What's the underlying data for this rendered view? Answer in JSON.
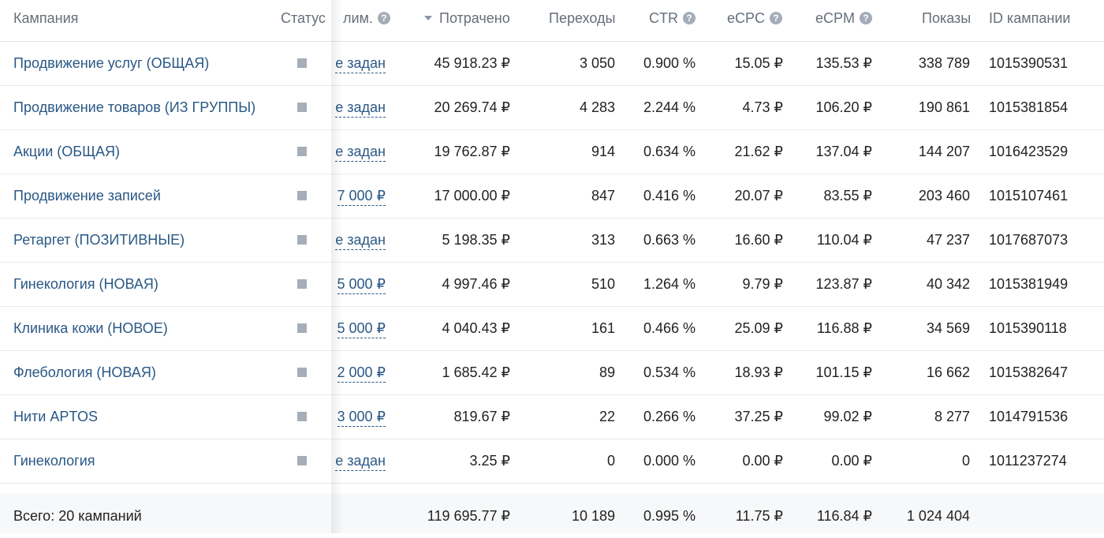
{
  "headers": {
    "campaign": "Кампания",
    "status": "Статус",
    "limit": "лим.",
    "spent": "Потрачено",
    "clicks": "Переходы",
    "ctr": "CTR",
    "ecpc": "eCPC",
    "ecpm": "eCPM",
    "impressions": "Показы",
    "campaign_id": "ID кампании",
    "help_glyph": "?"
  },
  "rows": [
    {
      "name": "Продвижение услуг (ОБЩАЯ)",
      "limit": "е задан",
      "spent": "45 918.23 ₽",
      "clicks": "3 050",
      "ctr": "0.900 %",
      "ecpc": "15.05 ₽",
      "ecpm": "135.53 ₽",
      "impressions": "338 789",
      "id": "1015390531"
    },
    {
      "name": "Продвижение товаров (ИЗ ГРУППЫ)",
      "limit": "е задан",
      "spent": "20 269.74 ₽",
      "clicks": "4 283",
      "ctr": "2.244 %",
      "ecpc": "4.73 ₽",
      "ecpm": "106.20 ₽",
      "impressions": "190 861",
      "id": "1015381854"
    },
    {
      "name": "Акции (ОБЩАЯ)",
      "limit": "е задан",
      "spent": "19 762.87 ₽",
      "clicks": "914",
      "ctr": "0.634 %",
      "ecpc": "21.62 ₽",
      "ecpm": "137.04 ₽",
      "impressions": "144 207",
      "id": "1016423529"
    },
    {
      "name": "Продвижение записей",
      "limit": "7 000 ₽",
      "spent": "17 000.00 ₽",
      "clicks": "847",
      "ctr": "0.416 %",
      "ecpc": "20.07 ₽",
      "ecpm": "83.55 ₽",
      "impressions": "203 460",
      "id": "1015107461"
    },
    {
      "name": "Ретаргет (ПОЗИТИВНЫЕ)",
      "limit": "е задан",
      "spent": "5 198.35 ₽",
      "clicks": "313",
      "ctr": "0.663 %",
      "ecpc": "16.60 ₽",
      "ecpm": "110.04 ₽",
      "impressions": "47 237",
      "id": "1017687073"
    },
    {
      "name": "Гинекология (НОВАЯ)",
      "limit": "5 000 ₽",
      "spent": "4 997.46 ₽",
      "clicks": "510",
      "ctr": "1.264 %",
      "ecpc": "9.79 ₽",
      "ecpm": "123.87 ₽",
      "impressions": "40 342",
      "id": "1015381949"
    },
    {
      "name": "Клиника кожи (НОВОЕ)",
      "limit": "5 000 ₽",
      "spent": "4 040.43 ₽",
      "clicks": "161",
      "ctr": "0.466 %",
      "ecpc": "25.09 ₽",
      "ecpm": "116.88 ₽",
      "impressions": "34 569",
      "id": "1015390118"
    },
    {
      "name": "Флебология (НОВАЯ)",
      "limit": "2 000 ₽",
      "spent": "1 685.42 ₽",
      "clicks": "89",
      "ctr": "0.534 %",
      "ecpc": "18.93 ₽",
      "ecpm": "101.15 ₽",
      "impressions": "16 662",
      "id": "1015382647"
    },
    {
      "name": "Нити APTOS",
      "limit": "3 000 ₽",
      "spent": "819.67 ₽",
      "clicks": "22",
      "ctr": "0.266 %",
      "ecpc": "37.25 ₽",
      "ecpm": "99.02 ₽",
      "impressions": "8 277",
      "id": "1014791536"
    },
    {
      "name": "Гинекология",
      "limit": "е задан",
      "spent": "3.25 ₽",
      "clicks": "0",
      "ctr": "0.000 %",
      "ecpc": "0.00 ₽",
      "ecpm": "0.00 ₽",
      "impressions": "0",
      "id": "1011237274"
    }
  ],
  "totals": {
    "label": "Всего: 20 кампаний",
    "spent": "119 695.77 ₽",
    "clicks": "10 189",
    "ctr": "0.995 %",
    "ecpc": "11.75 ₽",
    "ecpm": "116.84 ₽",
    "impressions": "1 024 404"
  },
  "icons": {
    "status": "status-square-icon",
    "help": "help-circle-icon",
    "sort": "sort-desc-arrow-icon"
  },
  "colors": {
    "link": "#2a5885",
    "header_text": "#656f7a",
    "status_square": "#a6aeb8"
  }
}
